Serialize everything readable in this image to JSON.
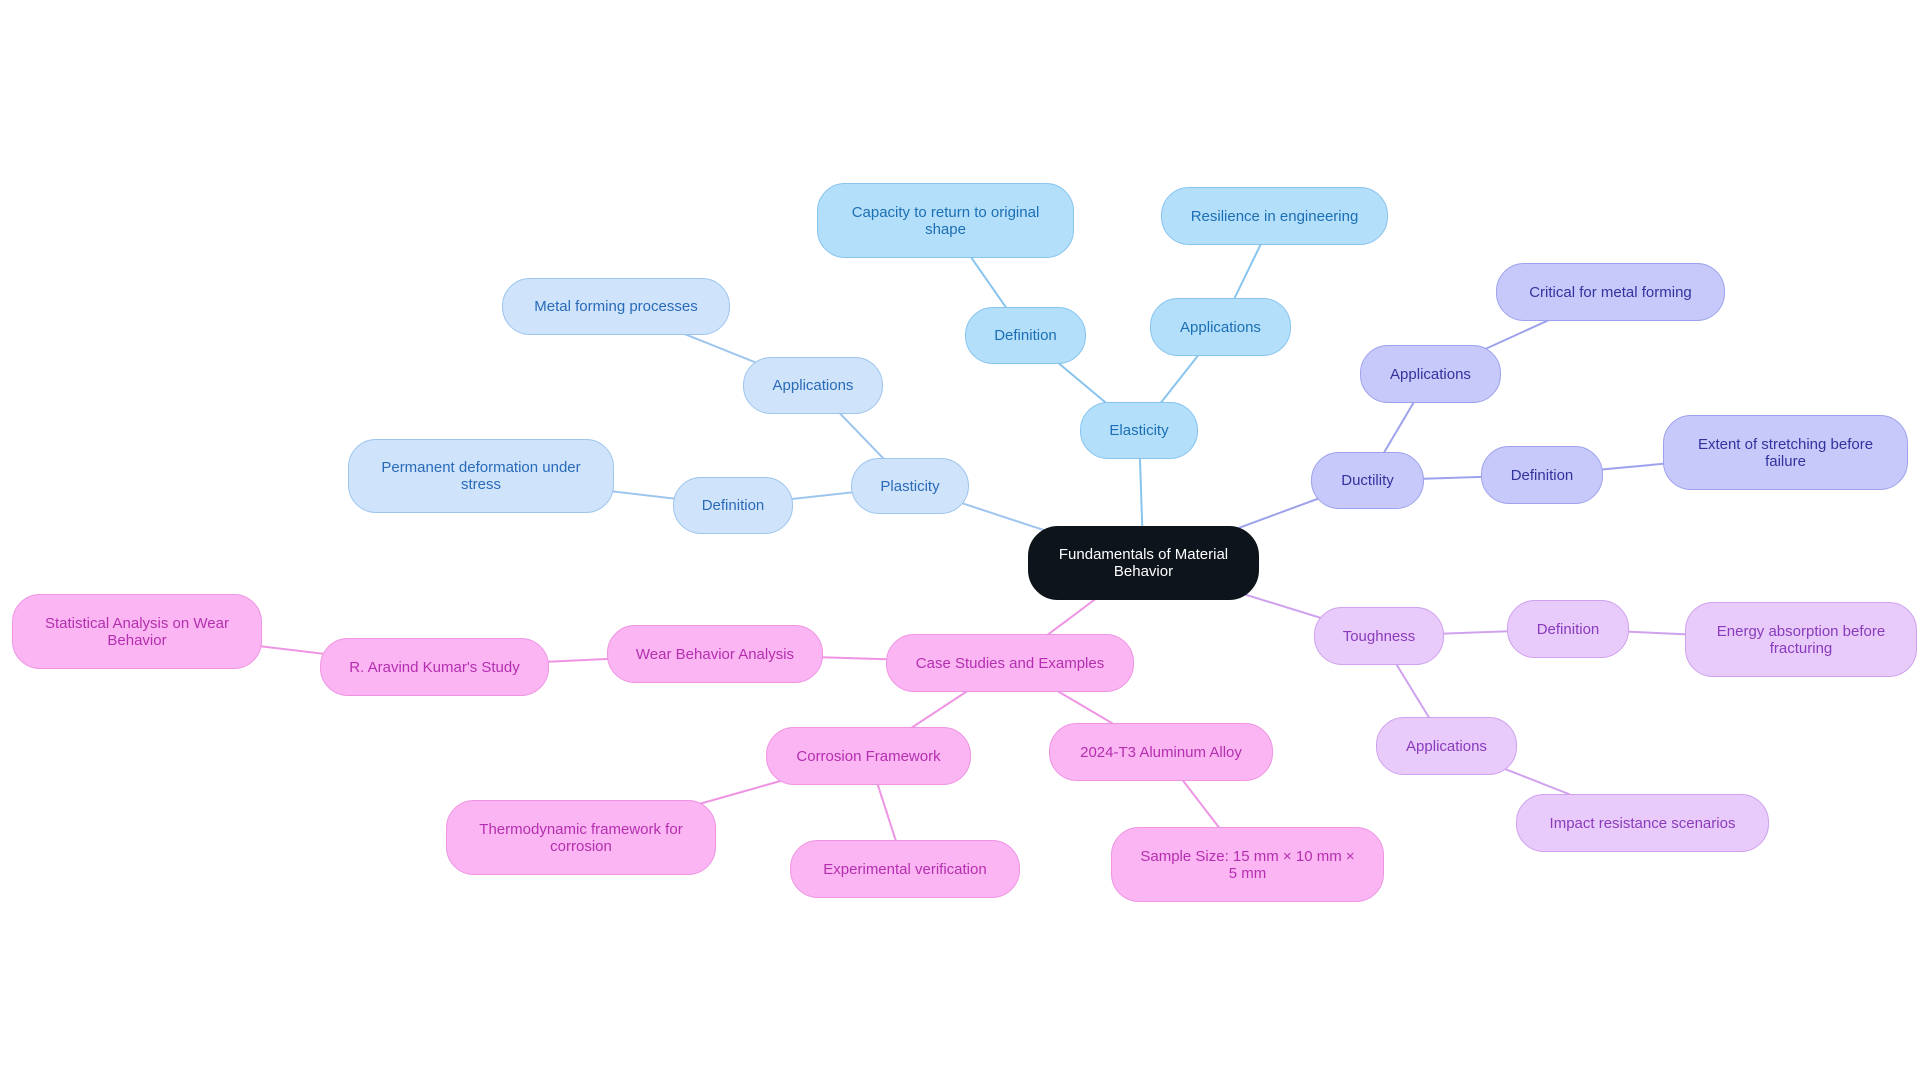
{
  "title": "Fundamentals of Material Behavior",
  "colors": {
    "root": "#0d141b",
    "plasticity": "#cfe3fb",
    "elasticity": "#b3dffb",
    "ductility": "#c7c9fb",
    "toughness": "#e8cbfb",
    "case_studies": "#fbb5f2"
  },
  "nodes": {
    "root": "Fundamentals of Material Behavior",
    "plasticity": "Plasticity",
    "plasticity_definition": "Definition",
    "plasticity_definition_text": "Permanent deformation under stress",
    "plasticity_applications": "Applications",
    "plasticity_applications_text": "Metal forming processes",
    "elasticity": "Elasticity",
    "elasticity_definition": "Definition",
    "elasticity_definition_text": "Capacity to return to original shape",
    "elasticity_applications": "Applications",
    "elasticity_applications_text": "Resilience in engineering",
    "ductility": "Ductility",
    "ductility_applications": "Applications",
    "ductility_applications_text": "Critical for metal forming",
    "ductility_definition": "Definition",
    "ductility_definition_text": "Extent of stretching before failure",
    "toughness": "Toughness",
    "toughness_definition": "Definition",
    "toughness_definition_text": "Energy absorption before fracturing",
    "toughness_applications": "Applications",
    "toughness_applications_text": "Impact resistance scenarios",
    "case_studies": "Case Studies and Examples",
    "wear_behavior": "Wear Behavior Analysis",
    "aravind_study": "R. Aravind Kumar's Study",
    "statistical_analysis": "Statistical Analysis on Wear Behavior",
    "corrosion_framework": "Corrosion Framework",
    "thermodynamic_framework": "Thermodynamic framework for corrosion",
    "experimental_verification": "Experimental verification",
    "aluminum_alloy": "2024-T3 Aluminum Alloy",
    "sample_size": "Sample Size: 15 mm × 10 mm × 5 mm"
  },
  "edges": [
    [
      "root",
      "plasticity"
    ],
    [
      "plasticity",
      "plasticity_definition"
    ],
    [
      "plasticity_definition",
      "plasticity_definition_text"
    ],
    [
      "plasticity",
      "plasticity_applications"
    ],
    [
      "plasticity_applications",
      "plasticity_applications_text"
    ],
    [
      "root",
      "elasticity"
    ],
    [
      "elasticity",
      "elasticity_definition"
    ],
    [
      "elasticity_definition",
      "elasticity_definition_text"
    ],
    [
      "elasticity",
      "elasticity_applications"
    ],
    [
      "elasticity_applications",
      "elasticity_applications_text"
    ],
    [
      "root",
      "ductility"
    ],
    [
      "ductility",
      "ductility_applications"
    ],
    [
      "ductility_applications",
      "ductility_applications_text"
    ],
    [
      "ductility",
      "ductility_definition"
    ],
    [
      "ductility_definition",
      "ductility_definition_text"
    ],
    [
      "root",
      "toughness"
    ],
    [
      "toughness",
      "toughness_definition"
    ],
    [
      "toughness_definition",
      "toughness_definition_text"
    ],
    [
      "toughness",
      "toughness_applications"
    ],
    [
      "toughness_applications",
      "toughness_applications_text"
    ],
    [
      "root",
      "case_studies"
    ],
    [
      "case_studies",
      "wear_behavior"
    ],
    [
      "wear_behavior",
      "aravind_study"
    ],
    [
      "aravind_study",
      "statistical_analysis"
    ],
    [
      "case_studies",
      "corrosion_framework"
    ],
    [
      "corrosion_framework",
      "thermodynamic_framework"
    ],
    [
      "corrosion_framework",
      "experimental_verification"
    ],
    [
      "case_studies",
      "aluminum_alloy"
    ],
    [
      "aluminum_alloy",
      "sample_size"
    ]
  ]
}
